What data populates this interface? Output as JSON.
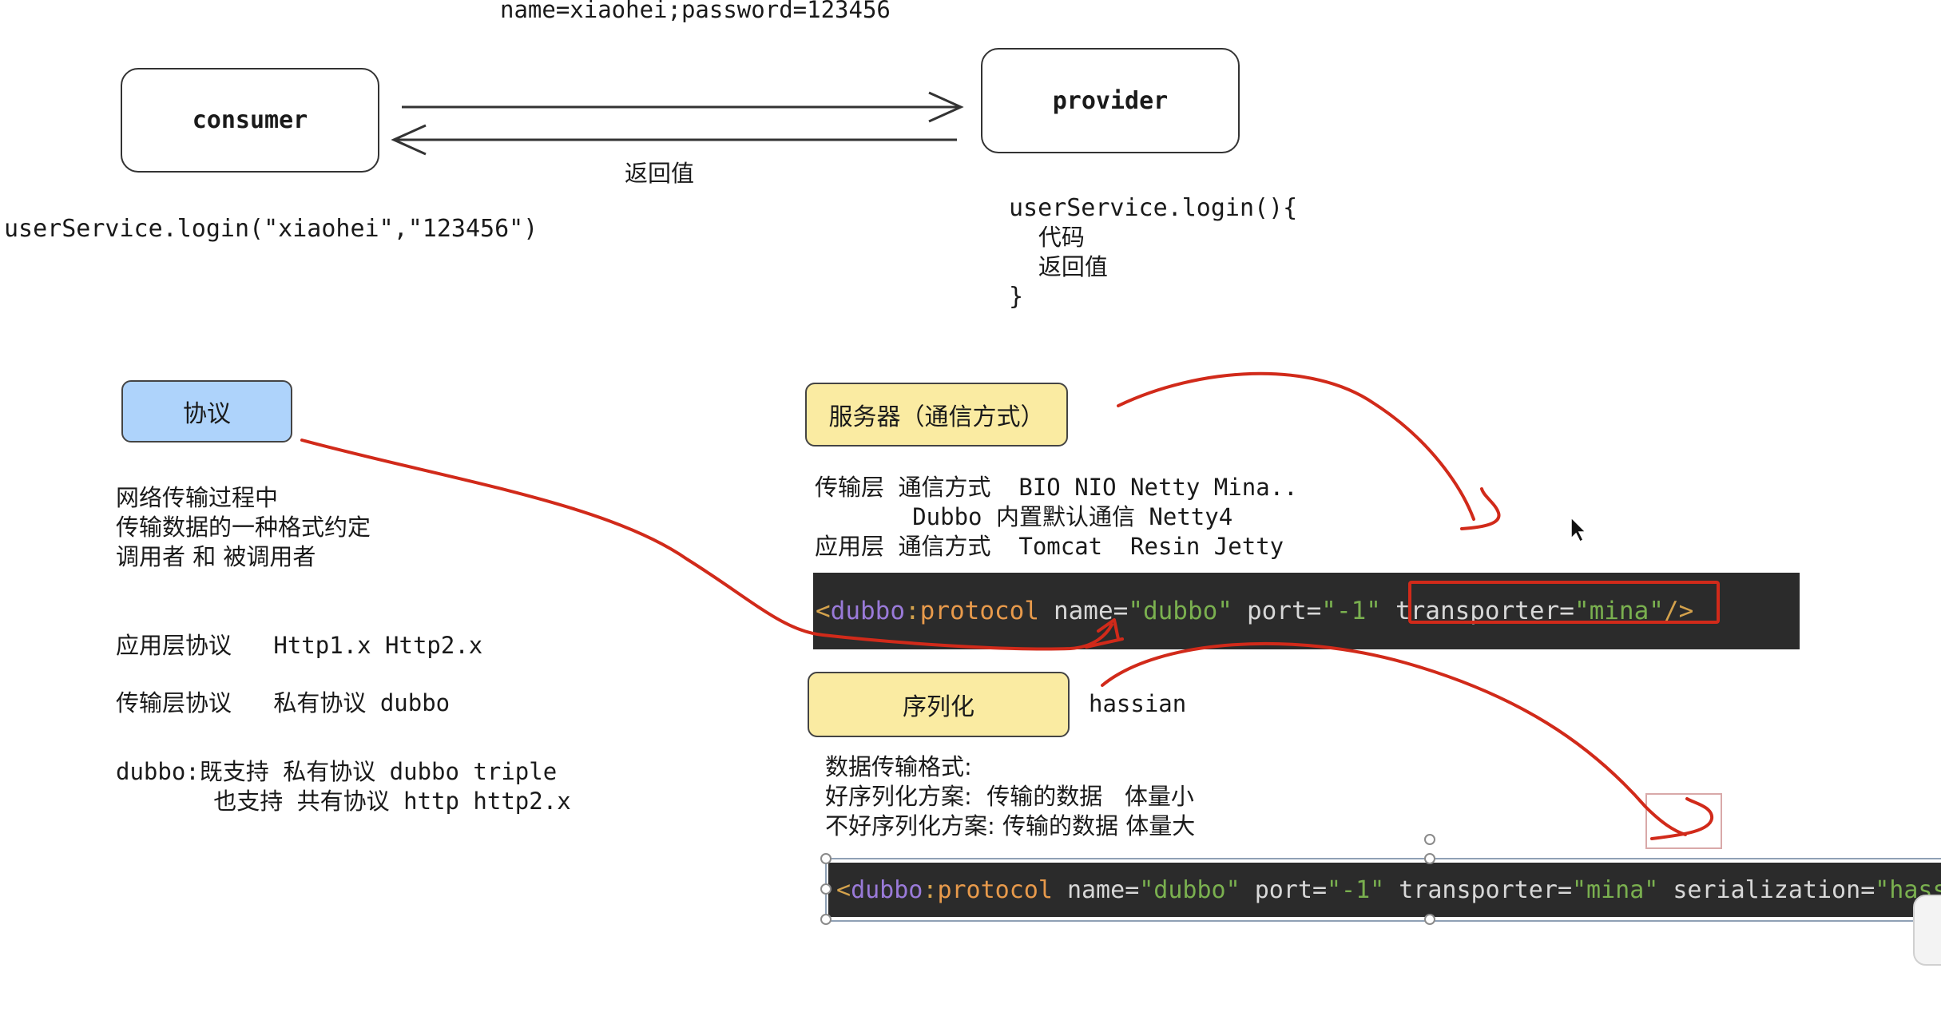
{
  "top": {
    "request_label": "name=xiaohei;password=123456",
    "consumer_label": "consumer",
    "provider_label": "provider",
    "return_label": "返回值",
    "consumer_call": "userService.login(\"xiaohei\",\"123456\")",
    "provider_code": [
      "userService.login(){",
      "    代码",
      "    返回值",
      "",
      "}"
    ]
  },
  "protocol": {
    "tag_label": "协议",
    "description": [
      "网络传输过程中",
      "传输数据的一种格式约定",
      "调用者 和 被调用者"
    ],
    "app_layer": "应用层协议   Http1.x Http2.x",
    "transport_layer": "传输层协议   私有协议 dubbo",
    "dubbo_support": [
      "dubbo:既支持 私有协议 dubbo triple",
      "       也支持 共有协议 http http2.x"
    ]
  },
  "server": {
    "tag_label": "服务器（通信方式）",
    "lines": [
      "传输层 通信方式  BIO NIO Netty Mina..",
      "       Dubbo 内置默认通信 Netty4",
      "应用层 通信方式  Tomcat  Resin Jetty"
    ],
    "code1": {
      "open": "<",
      "ns": "dubbo",
      "colon": ":",
      "tag": "protocol",
      "attrs": [
        {
          "name": "name",
          "value": "\"dubbo\""
        },
        {
          "name": "port",
          "value": "\"-1\""
        },
        {
          "name": "transporter",
          "value": "\"mina\""
        }
      ],
      "close": "/>"
    }
  },
  "serialization": {
    "tag_label": "序列化",
    "hassian": "hassian",
    "lines": [
      "数据传输格式:",
      "好序列化方案:  传输的数据   体量小",
      "不好序列化方案: 传输的数据 体量大"
    ],
    "code2": {
      "open": "<",
      "ns": "dubbo",
      "colon": ":",
      "tag": "protocol",
      "attrs": [
        {
          "name": "name",
          "value": "\"dubbo\""
        },
        {
          "name": "port",
          "value": "\"-1\""
        },
        {
          "name": "transporter",
          "value": "\"mina\""
        },
        {
          "name": "serialization",
          "value": "\"hass"
        }
      ]
    }
  },
  "colors": {
    "annotation_red": "#d12a1a",
    "tag_blue": "#aed3fb",
    "tag_yellow": "#faeba2",
    "code_bg": "#2b2b2b"
  }
}
